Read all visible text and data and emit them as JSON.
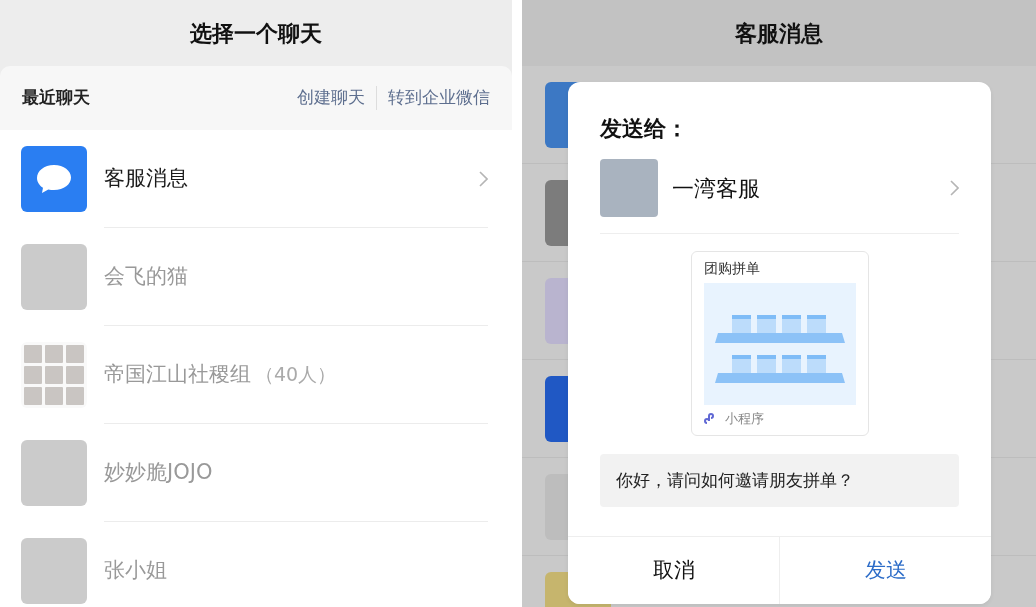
{
  "left_screen": {
    "title": "选择一个聊天",
    "section": {
      "title": "最近聊天",
      "actions": [
        "创建聊天",
        "转到企业微信"
      ]
    },
    "chats": [
      {
        "name": "客服消息",
        "kind": "service",
        "disabled": false
      },
      {
        "name": "会飞的猫",
        "kind": "person",
        "disabled": true
      },
      {
        "name": "帝国江山社稷组",
        "member_count": "（40人）",
        "kind": "group",
        "disabled": true
      },
      {
        "name": "妙妙脆JOJO",
        "kind": "person",
        "disabled": true
      },
      {
        "name": "张小姐",
        "kind": "person",
        "disabled": true
      }
    ]
  },
  "right_screen": {
    "title": "客服消息",
    "dialog": {
      "heading": "发送给：",
      "recipient": {
        "name": "一湾客服"
      },
      "card": {
        "title": "团购拼单",
        "source": "小程序"
      },
      "message": "你好，请问如何邀请朋友拼单？",
      "buttons": [
        {
          "label": "取消",
          "kind": "cancel"
        },
        {
          "label": "发送",
          "kind": "primary"
        }
      ]
    }
  }
}
